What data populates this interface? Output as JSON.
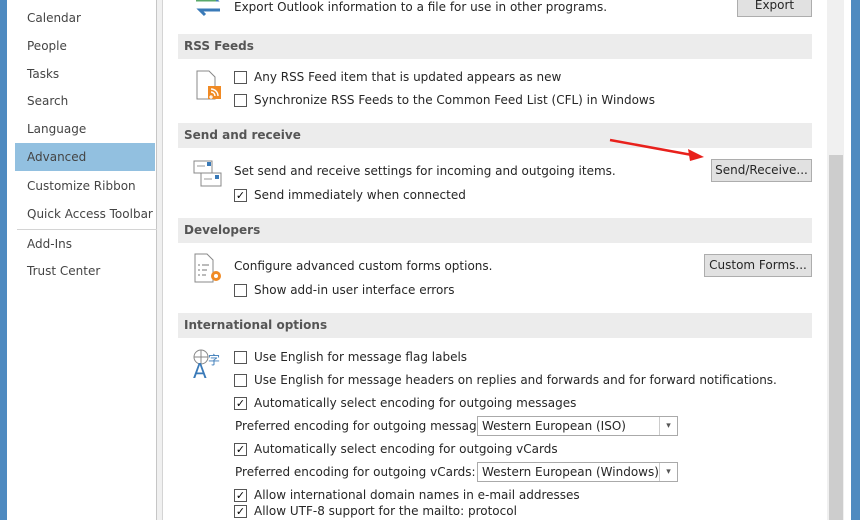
{
  "sidebar": {
    "items": [
      "Calendar",
      "People",
      "Tasks",
      "Search",
      "Language",
      "Advanced",
      "Customize Ribbon",
      "Quick Access Toolbar",
      "Add-Ins",
      "Trust Center"
    ],
    "active": "Advanced"
  },
  "export": {
    "text": "Export Outlook information to a file for use in other programs.",
    "button": "Export"
  },
  "rss": {
    "header": "RSS Feeds",
    "opt1": "Any RSS Feed item that is updated appears as new",
    "opt1_checked": false,
    "opt2": "Synchronize RSS Feeds to the Common Feed List (CFL) in Windows",
    "opt2_checked": false
  },
  "sendreceive": {
    "header": "Send and receive",
    "desc": "Set send and receive settings for incoming and outgoing items.",
    "button": "Send/Receive...",
    "opt1": "Send immediately when connected",
    "opt1_checked": true
  },
  "developers": {
    "header": "Developers",
    "desc": "Configure advanced custom forms options.",
    "button": "Custom Forms...",
    "opt1": "Show add-in user interface errors",
    "opt1_checked": false
  },
  "international": {
    "header": "International options",
    "opt1": "Use English for message flag labels",
    "opt1_checked": false,
    "opt2": "Use English for message headers on replies and forwards and for forward notifications.",
    "opt2_checked": false,
    "opt3": "Automatically select encoding for outgoing messages",
    "opt3_checked": true,
    "enc_msg_label": "Preferred encoding for outgoing messages:",
    "enc_msg_value": "Western European (ISO)",
    "opt4": "Automatically select encoding for outgoing vCards",
    "opt4_checked": true,
    "enc_vcard_label": "Preferred encoding for outgoing vCards:",
    "enc_vcard_value": "Western European (Windows)",
    "opt5": "Allow international domain names in e-mail addresses",
    "opt5_checked": true,
    "opt6": "Allow UTF-8 support for the mailto: protocol",
    "opt6_checked": true
  },
  "colors": {
    "accent": "#92c0e0",
    "arrow": "#e8211c",
    "frame": "#4e8ac0"
  }
}
